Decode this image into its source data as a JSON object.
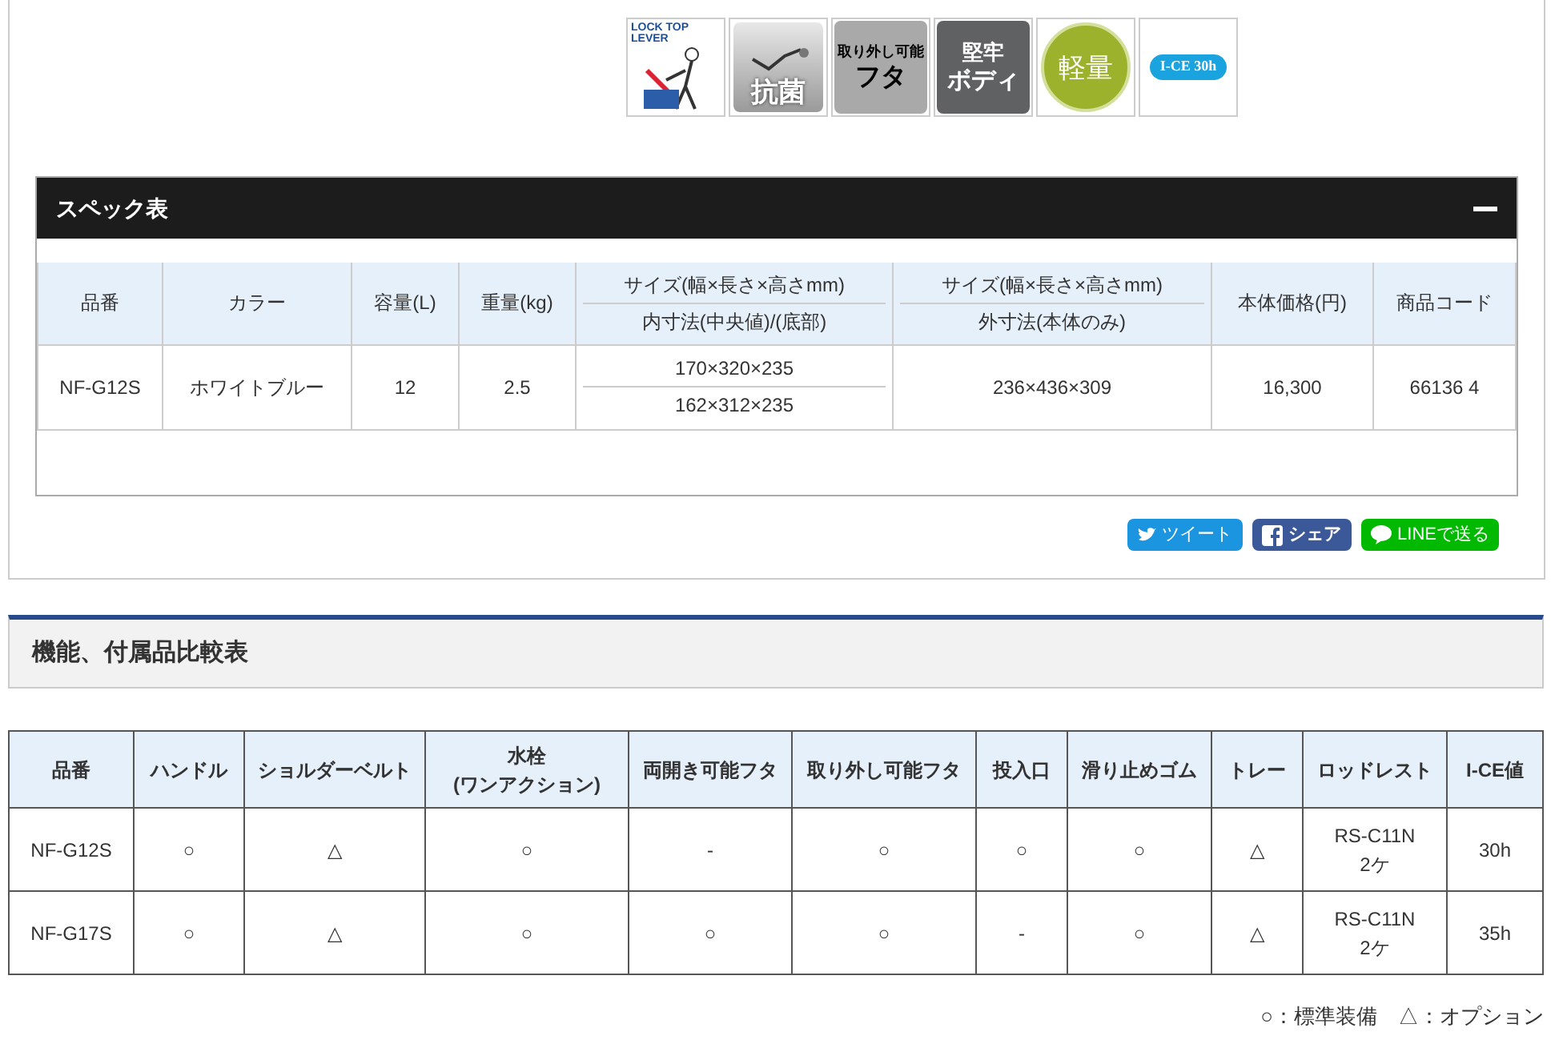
{
  "badges": [
    {
      "kind": "lever",
      "lines": [
        "LOCK TOP LEVER"
      ]
    },
    {
      "kind": "silver",
      "lines": [
        "抗菌"
      ]
    },
    {
      "kind": "lightgrey",
      "lines": [
        "取り外し可能",
        "フタ"
      ]
    },
    {
      "kind": "darkgrey",
      "lines": [
        "堅牢",
        "ボディ"
      ]
    },
    {
      "kind": "circle",
      "lines": [
        "軽量"
      ]
    },
    {
      "kind": "pill",
      "lines": [
        "I-CE 30h"
      ]
    }
  ],
  "spec": {
    "title": "スペック表",
    "expanded": true,
    "columns": [
      "品番",
      "カラー",
      "容量(L)",
      "重量(kg)",
      {
        "parts": [
          "サイズ(幅×長さ×高さmm)",
          "内寸法(中央値)/(底部)"
        ]
      },
      {
        "parts": [
          "サイズ(幅×長さ×高さmm)",
          "外寸法(本体のみ)"
        ]
      },
      "本体価格(円)",
      "商品コード"
    ],
    "rows": [
      [
        "NF-G12S",
        "ホワイトブルー",
        "12",
        "2.5",
        {
          "parts": [
            "170×320×235",
            "162×312×235"
          ]
        },
        "236×436×309",
        "16,300",
        "66136 4"
      ]
    ]
  },
  "share": [
    {
      "kind": "twitter",
      "label": "ツイート"
    },
    {
      "kind": "facebook",
      "label": "シェア"
    },
    {
      "kind": "line",
      "label": "LINEで送る"
    }
  ],
  "compare": {
    "title": "機能、付属品比較表",
    "columns": [
      "品番",
      "ハンドル",
      "ショルダーベルト",
      "水栓\n(ワンアクション)",
      "両開き可能フタ",
      "取り外し可能フタ",
      "投入口",
      "滑り止めゴム",
      "トレー",
      "ロッドレスト",
      "I-CE値"
    ],
    "rows": [
      [
        "NF-G12S",
        "○",
        "△",
        "○",
        "-",
        "○",
        "○",
        "○",
        "△",
        "RS-C11N\n2ケ",
        "30h"
      ],
      [
        "NF-G17S",
        "○",
        "△",
        "○",
        "○",
        "○",
        "-",
        "○",
        "△",
        "RS-C11N\n2ケ",
        "35h"
      ]
    ],
    "legend": "○：標準装備　△：オプション"
  }
}
